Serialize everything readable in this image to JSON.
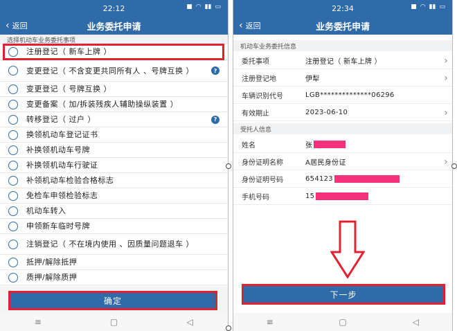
{
  "left": {
    "status": {
      "time": "22:12"
    },
    "title": "业务委托申请",
    "back": "返回",
    "section": "选择机动车业务委托事项",
    "options": [
      {
        "label": "注册登记（ 新车上牌 ）",
        "help": false
      },
      {
        "label": "变更登记（ 不含变更共同所有人 、号牌互换 ）",
        "help": true
      },
      {
        "label": "变更登记（ 号牌互换 ）",
        "help": false
      },
      {
        "label": "变更备案（ 加/拆装残疾人辅助操纵装置 ）",
        "help": false
      },
      {
        "label": "转移登记（ 过户 ）",
        "help": true
      },
      {
        "label": "换领机动车登记证书",
        "help": false
      },
      {
        "label": "补换领机动车号牌",
        "help": false
      },
      {
        "label": "补换领机动车行驶证",
        "help": false
      },
      {
        "label": "补领机动车检验合格标志",
        "help": false
      },
      {
        "label": "免检车申领检验标志",
        "help": false
      },
      {
        "label": "机动车转入",
        "help": false
      },
      {
        "label": "申领新车临时号牌",
        "help": false
      },
      {
        "label": "注销登记（ 不在境内使用 、因质量问题退车 ）",
        "help": false
      },
      {
        "label": "抵押/解除抵押",
        "help": false
      },
      {
        "label": "质押/解除质押",
        "help": false
      }
    ],
    "help_glyph": "?",
    "confirm": "确定"
  },
  "right": {
    "status": {
      "time": "22:34"
    },
    "title": "业务委托申请",
    "back": "返回",
    "vehicle_section": "机动车业务委托信息",
    "vehicle_rows": [
      {
        "label": "委托事项",
        "value": "注册登记（ 新车上牌 ）",
        "chevron": true
      },
      {
        "label": "注册登记地",
        "value": "伊犁",
        "chevron": true
      },
      {
        "label": "车辆识别代号",
        "value": "LGB**************06296",
        "chevron": false
      },
      {
        "label": "有效期止",
        "value": "2023-06-10",
        "chevron": true
      }
    ],
    "client_section": "受托人信息",
    "client_rows": [
      {
        "label": "姓名",
        "value": "张",
        "chevron": false
      },
      {
        "label": "身份证明名称",
        "value": "A居民身份证",
        "chevron": true
      },
      {
        "label": "身份证明号码",
        "value": "654123",
        "chevron": false
      },
      {
        "label": "手机号码",
        "value": "15",
        "chevron": false
      }
    ],
    "next": "下一步"
  },
  "colors": {
    "primary": "#2f6aa9",
    "highlight": "#e32030",
    "redact": "#f2317a"
  }
}
